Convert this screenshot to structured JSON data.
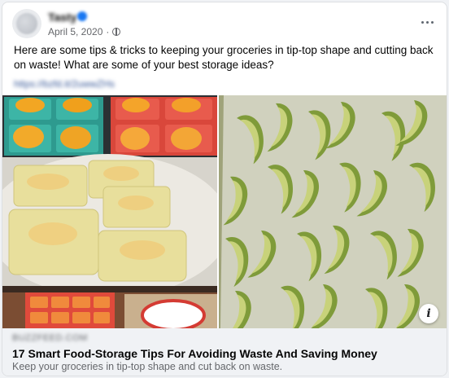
{
  "post": {
    "author": "Tasty",
    "date": "April 5, 2020",
    "separator": "·",
    "text": "Here are some tips & tricks to keeping your groceries in tip-top shape and cutting back on waste! What are some of your best storage ideas?",
    "link_url": "https://bzfd.it/2uwwZHs"
  },
  "icons": {
    "more": "more-options-icon",
    "privacy": "globe-icon",
    "info": "info-icon"
  },
  "link_preview": {
    "domain": "BUZZFEED.COM",
    "title": "17 Smart Food-Storage Tips For Avoiding Waste And Saving Money",
    "subtitle": "Keep your groceries in tip-top shape and cut back on waste.",
    "info_glyph": "i"
  },
  "colors": {
    "link": "#385898",
    "secondary_text": "#65676b",
    "preview_bg": "#f0f2f5"
  }
}
